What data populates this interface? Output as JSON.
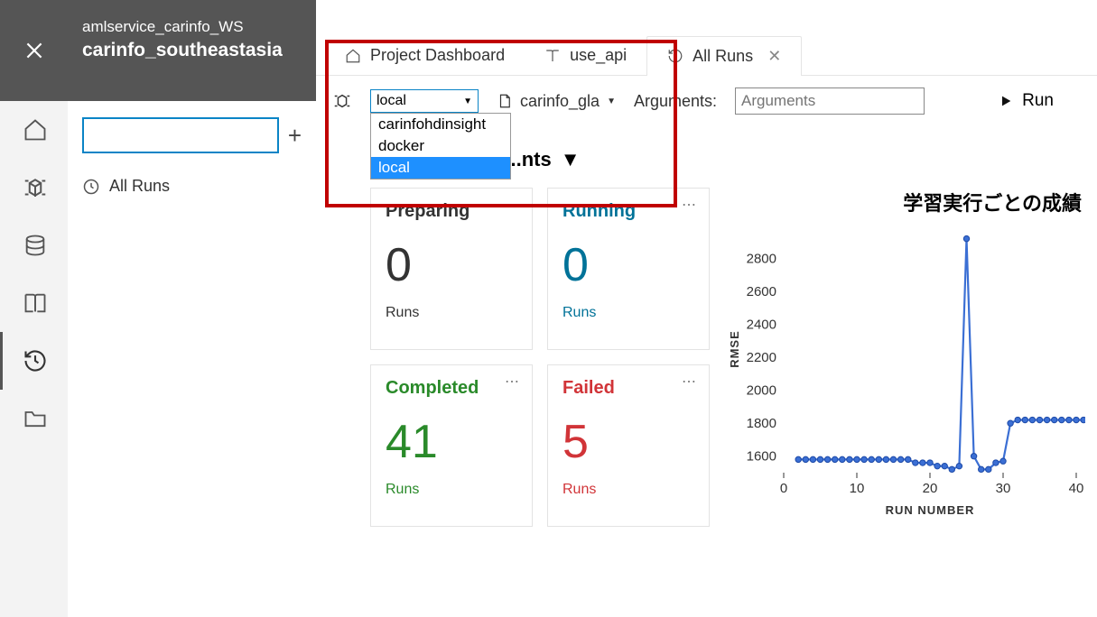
{
  "workspace": {
    "subtitle": "amlservice_carinfo_WS",
    "title": "carinfo_southeastasia",
    "all_runs_label": "All Runs"
  },
  "tabs": [
    {
      "label": "Project Dashboard",
      "icon": "home",
      "active": false
    },
    {
      "label": "use_api",
      "icon": "book",
      "active": false
    },
    {
      "label": "All Runs",
      "icon": "history",
      "active": true
    }
  ],
  "toolbar": {
    "compute_selected": "local",
    "compute_options": [
      "carinfohdinsight",
      "docker",
      "local"
    ],
    "file_label": "carinfo_gla",
    "args_label": "Arguments:",
    "args_placeholder": "Arguments",
    "run_label": "Run"
  },
  "experiments_header": "....nts",
  "cards": {
    "preparing": {
      "title": "Preparing",
      "value": "0",
      "unit": "Runs"
    },
    "running": {
      "title": "Running",
      "value": "0",
      "unit": "Runs"
    },
    "completed": {
      "title": "Completed",
      "value": "41",
      "unit": "Runs"
    },
    "failed": {
      "title": "Failed",
      "value": "5",
      "unit": "Runs"
    }
  },
  "chart_data": {
    "type": "line",
    "title": "学習実行ごとの成績",
    "xlabel": "RUN NUMBER",
    "ylabel": "RMSE",
    "xlim": [
      0,
      40
    ],
    "ylim": [
      1500,
      3000
    ],
    "x_ticks": [
      0,
      10,
      20,
      30,
      40
    ],
    "y_ticks": [
      1600,
      1800,
      2000,
      2200,
      2400,
      2600,
      2800
    ],
    "x": [
      2,
      3,
      4,
      5,
      6,
      7,
      8,
      9,
      10,
      11,
      12,
      13,
      14,
      15,
      16,
      17,
      18,
      19,
      20,
      21,
      22,
      23,
      24,
      25,
      26,
      27,
      28,
      29,
      30,
      31,
      32,
      33,
      34,
      35,
      36,
      37,
      38,
      39,
      40,
      41
    ],
    "values": [
      1580,
      1580,
      1580,
      1580,
      1580,
      1580,
      1580,
      1580,
      1580,
      1580,
      1580,
      1580,
      1580,
      1580,
      1580,
      1580,
      1560,
      1560,
      1560,
      1540,
      1540,
      1520,
      1540,
      2920,
      1600,
      1520,
      1520,
      1560,
      1570,
      1800,
      1820,
      1820,
      1820,
      1820,
      1820,
      1820,
      1820,
      1820,
      1820,
      1820
    ]
  }
}
